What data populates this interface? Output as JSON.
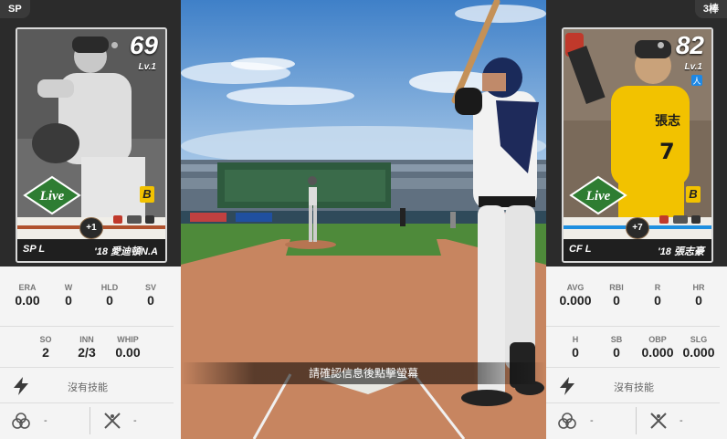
{
  "left_player": {
    "tag": "SP",
    "overall": "69",
    "level": "Lv.1",
    "badge": "+1",
    "position": "SP",
    "hand": "L",
    "name": "'18 愛迪頓N.A",
    "stripe_color": "#b0522e",
    "stats_row1": [
      {
        "key": "ERA",
        "value": "0.00"
      },
      {
        "key": "W",
        "value": "0"
      },
      {
        "key": "HLD",
        "value": "0"
      },
      {
        "key": "SV",
        "value": "0"
      }
    ],
    "stats_row2": [
      {
        "key": "SO",
        "value": "2"
      },
      {
        "key": "INN",
        "value": "2/3"
      },
      {
        "key": "WHIP",
        "value": "0.00"
      }
    ],
    "skill_text": "沒有技能",
    "bottom_left": "-",
    "bottom_right": "-"
  },
  "right_player": {
    "tag": "3棒",
    "overall": "82",
    "level": "Lv.1",
    "badge": "+7",
    "position": "CF",
    "hand": "L",
    "name": "'18 張志豪",
    "stripe_color": "#1e8fe0",
    "stats_row1": [
      {
        "key": "AVG",
        "value": "0.000"
      },
      {
        "key": "RBI",
        "value": "0"
      },
      {
        "key": "R",
        "value": "0"
      },
      {
        "key": "HR",
        "value": "0"
      }
    ],
    "stats_row2": [
      {
        "key": "H",
        "value": "0"
      },
      {
        "key": "SB",
        "value": "0"
      },
      {
        "key": "OBP",
        "value": "0.000"
      },
      {
        "key": "SLG",
        "value": "0.000"
      }
    ],
    "skill_text": "沒有技能",
    "bottom_left": "-",
    "bottom_right": "-"
  },
  "card_logo_text": "Live",
  "team_letter": "B",
  "message": "請確認信息後點擊螢幕",
  "colors": {
    "sky": "#5a9ad8",
    "grass": "#4e8a3a",
    "dirt": "#c78560",
    "panel": "#f4f4f4"
  }
}
